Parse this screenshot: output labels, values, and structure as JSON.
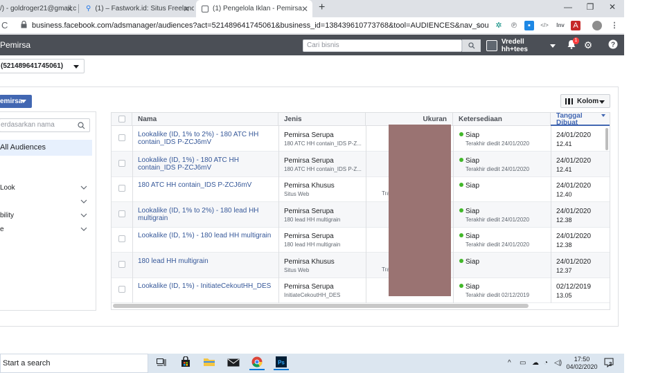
{
  "browser": {
    "tabs": [
      {
        "label": "/) - goldroger21@gmail.c",
        "favicon": "M"
      },
      {
        "label": "(1) – Fastwork.id: Situs Freelance",
        "favicon": "F"
      },
      {
        "label": "(1) Pengelola Iklan - Pemirsa",
        "favicon": "▣"
      }
    ],
    "new_tab": "+",
    "window_controls": [
      "—",
      "❐",
      "✕"
    ],
    "url": "business.facebook.com/adsmanager/audiences?act=521489641745061&business_id=138439610773768&tool=AUDIENCES&nav_source=fl...",
    "ext_inv": "Inv"
  },
  "fb_header": {
    "title": "Pemirsa",
    "search_placeholder": "Cari bisnis",
    "account_name": "Vredell hh+tees",
    "notif_count": "1"
  },
  "account_selector": "(521489641745061)",
  "create_button": "emirsa",
  "sidebar": {
    "search_placeholder": "erdasarkan nama",
    "all_audiences": "All Audiences",
    "filters": [
      {
        "label": " Look"
      },
      {
        "label": ""
      },
      {
        "label": "bility"
      },
      {
        "label": "e"
      }
    ]
  },
  "kolom_label": "Kolom",
  "table": {
    "headers": {
      "name": "Nama",
      "type": "Jenis",
      "size": "Ukuran",
      "availability": "Ketersediaan",
      "date": "Tanggal Dibuat"
    },
    "rows": [
      {
        "name": "Lookalike (ID, 1% to 2%) - 180 ATC HH contain_IDS P-ZCJ6mV",
        "type": "Pemirsa Serupa",
        "sub": "180 ATC HH contain_IDS P-Z...",
        "status": "Siap",
        "edited": "Terakhir diedit 24/01/2020",
        "date": "24/01/2020",
        "time": "12.41",
        "tra": ""
      },
      {
        "name": "Lookalike (ID, 1%) - 180 ATC HH contain_IDS P-ZCJ6mV",
        "type": "Pemirsa Serupa",
        "sub": "180 ATC HH contain_IDS P-Z...",
        "status": "Siap",
        "edited": "Terakhir diedit 24/01/2020",
        "date": "24/01/2020",
        "time": "12.41",
        "tra": ""
      },
      {
        "name": "180 ATC HH contain_IDS P-ZCJ6mV",
        "type": "Pemirsa Khusus",
        "sub": "Situs Web",
        "status": "Siap",
        "edited": "",
        "date": "24/01/2020",
        "time": "12.40",
        "tra": "Tra"
      },
      {
        "name": "Lookalike (ID, 1% to 2%) - 180 lead HH multigrain",
        "type": "Pemirsa Serupa",
        "sub": "180 lead HH multigrain",
        "status": "Siap",
        "edited": "Terakhir diedit 24/01/2020",
        "date": "24/01/2020",
        "time": "12.38",
        "tra": ""
      },
      {
        "name": "Lookalike (ID, 1%) - 180 lead HH multigrain",
        "type": "Pemirsa Serupa",
        "sub": "180 lead HH multigrain",
        "status": "Siap",
        "edited": "Terakhir diedit 24/01/2020",
        "date": "24/01/2020",
        "time": "12.38",
        "tra": ""
      },
      {
        "name": "180 lead HH multigrain",
        "type": "Pemirsa Khusus",
        "sub": "Situs Web",
        "status": "Siap",
        "edited": "",
        "date": "24/01/2020",
        "time": "12.37",
        "tra": "Tra"
      },
      {
        "name": "Lookalike (ID, 1%) - InitiateCekoutHH_DES",
        "type": "Pemirsa Serupa",
        "sub": "InitiateCekoutHH_DES",
        "status": "Siap",
        "edited": "Terakhir diedit 02/12/2019",
        "date": "02/12/2019",
        "time": "13.05",
        "tra": ""
      }
    ]
  },
  "taskbar": {
    "search_label": "Start a search",
    "time": "17:50",
    "date": "04/02/2020",
    "notif_count": "3"
  },
  "colors": {
    "fb_blue": "#4267b2",
    "link_blue": "#365899",
    "header_gray": "#4b4f56",
    "status_green": "#42b72a",
    "redaction": "#9a7372"
  }
}
